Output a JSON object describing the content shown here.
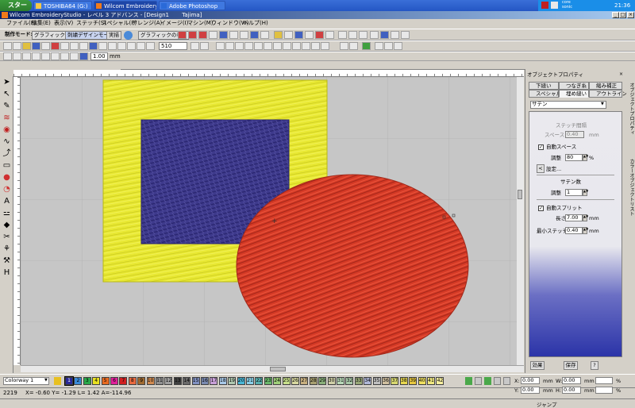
{
  "taskbar": {
    "start": "スタート",
    "tasks": [
      "TOSHIBA64 (G:)",
      "Wilcom EmbroideryS...",
      "Adobe Photoshop"
    ],
    "tray_lines": [
      "core",
      "sonic"
    ],
    "clock": "21:36"
  },
  "window": {
    "title": "Wilcom EmbroideryStudio - レベル 3 アドバンス - [Design1",
    "title_suffix": "Tajima]"
  },
  "menu": [
    "ファイル(F)",
    "編集(E)",
    "表示(V)",
    "ステッチ(S)",
    "スペシャル(P)",
    "アレンジ(A)",
    "イメージ(I)",
    "マシン(M)",
    "ウィンドウ(W)",
    "ヘルプ(H)"
  ],
  "toolbar": {
    "mode_label": "制作モード:",
    "graphics_mode": "グラフィックモード",
    "stitch_design_mode": "刺繍デザインモード",
    "realistic": "実描",
    "graphics_display": "グラフィックの表示",
    "zoom_value": "510",
    "size_value": "1.00",
    "size_unit": "mm"
  },
  "panel": {
    "title": "オブジェクトプロパティ",
    "tabs": [
      "下縫い",
      "つなぎ糸",
      "縮み補正",
      "スペシャル",
      "埋め縫い",
      "アウトライン"
    ],
    "stitch_type": "サテン",
    "stitch_spacing_header": "ステッチ間隔",
    "space_label": "スペース",
    "space_value": "0.40",
    "space_unit": "mm",
    "auto_space_label": "自動スペース",
    "adjust_label": "調整",
    "adjust_value": "80",
    "adjust_unit": "%",
    "settings_label": "設定...",
    "satin_header": "サテン数",
    "adjust2_label": "調整",
    "adjust2_value": "1",
    "auto_split_label": "自動スプリット",
    "length_label": "長さ",
    "length_value": "7.00",
    "length_unit": "mm",
    "min_stitch_label": "最小ステッチ長",
    "min_stitch_value": "0.40",
    "min_stitch_unit": "mm",
    "effects_button": "効果",
    "save_button": "保存",
    "help_button": "?",
    "side_tabs": [
      "オブジェクトプロパティ",
      "カラーオブジェクトリスト"
    ]
  },
  "colorbar": {
    "colorway": "Colorway 1",
    "swatches": [
      {
        "n": "1",
        "c": "#2a2a9a"
      },
      {
        "n": "2",
        "c": "#3a8ad8"
      },
      {
        "n": "3",
        "c": "#2aa84a"
      },
      {
        "n": "4",
        "c": "#e8e020"
      },
      {
        "n": "5",
        "c": "#e86a20"
      },
      {
        "n": "6",
        "c": "#e0209a"
      },
      {
        "n": "7",
        "c": "#d02020"
      },
      {
        "n": "8",
        "c": "#e86a40"
      },
      {
        "n": "9",
        "c": "#a06a30"
      },
      {
        "n": "10",
        "c": "#d08a50"
      },
      {
        "n": "11",
        "c": "#909090"
      },
      {
        "n": "12",
        "c": "#a0a0a0"
      },
      {
        "n": "13",
        "c": "#404040"
      },
      {
        "n": "14",
        "c": "#6a6a6a"
      },
      {
        "n": "15",
        "c": "#8090c0"
      },
      {
        "n": "16",
        "c": "#7a8ab0"
      },
      {
        "n": "17",
        "c": "#c8a0d8"
      },
      {
        "n": "18",
        "c": "#a8c8e8"
      },
      {
        "n": "19",
        "c": "#b0c8b0"
      },
      {
        "n": "20",
        "c": "#4ab8d8"
      },
      {
        "n": "21",
        "c": "#8ad0e8"
      },
      {
        "n": "22",
        "c": "#58b0b0"
      },
      {
        "n": "23",
        "c": "#6ab86a"
      },
      {
        "n": "24",
        "c": "#a0d07a"
      },
      {
        "n": "25",
        "c": "#c8e08a"
      },
      {
        "n": "26",
        "c": "#d8d8a0"
      },
      {
        "n": "27",
        "c": "#c8b080"
      },
      {
        "n": "28",
        "c": "#a8a070"
      },
      {
        "n": "29",
        "c": "#8ab07a"
      },
      {
        "n": "30",
        "c": "#d0d0a8"
      },
      {
        "n": "31",
        "c": "#b8d8b8"
      },
      {
        "n": "32",
        "c": "#a8c8a8"
      },
      {
        "n": "33",
        "c": "#98a878"
      },
      {
        "n": "34",
        "c": "#b0b8d8"
      },
      {
        "n": "35",
        "c": "#c0c0c0"
      },
      {
        "n": "36",
        "c": "#d0c0a0"
      },
      {
        "n": "37",
        "c": "#d8d870"
      },
      {
        "n": "38",
        "c": "#e8d850"
      },
      {
        "n": "39",
        "c": "#e8c840"
      },
      {
        "n": "40",
        "c": "#f0e060"
      },
      {
        "n": "41",
        "c": "#f0e880"
      },
      {
        "n": "42",
        "c": "#f8f0a0"
      }
    ]
  },
  "status": {
    "stitch_count": "2219",
    "coords": "X= -0.60  Y= -1.29  L= 1.42  A=-114.96",
    "x_label": "X:",
    "y_label": "Y:",
    "x_value": "0.00",
    "y_value": "0.00",
    "unit": "mm",
    "w_label": "W:",
    "h_label": "H:",
    "w_value": "0.00",
    "h_value": "0.00",
    "pct": "%",
    "jump": "ジャンプ"
  },
  "colors": {
    "yellow": "#e8e832",
    "navy": "#3e3a8c",
    "red": "#d63a26",
    "canvas": "#c6c6c6"
  }
}
